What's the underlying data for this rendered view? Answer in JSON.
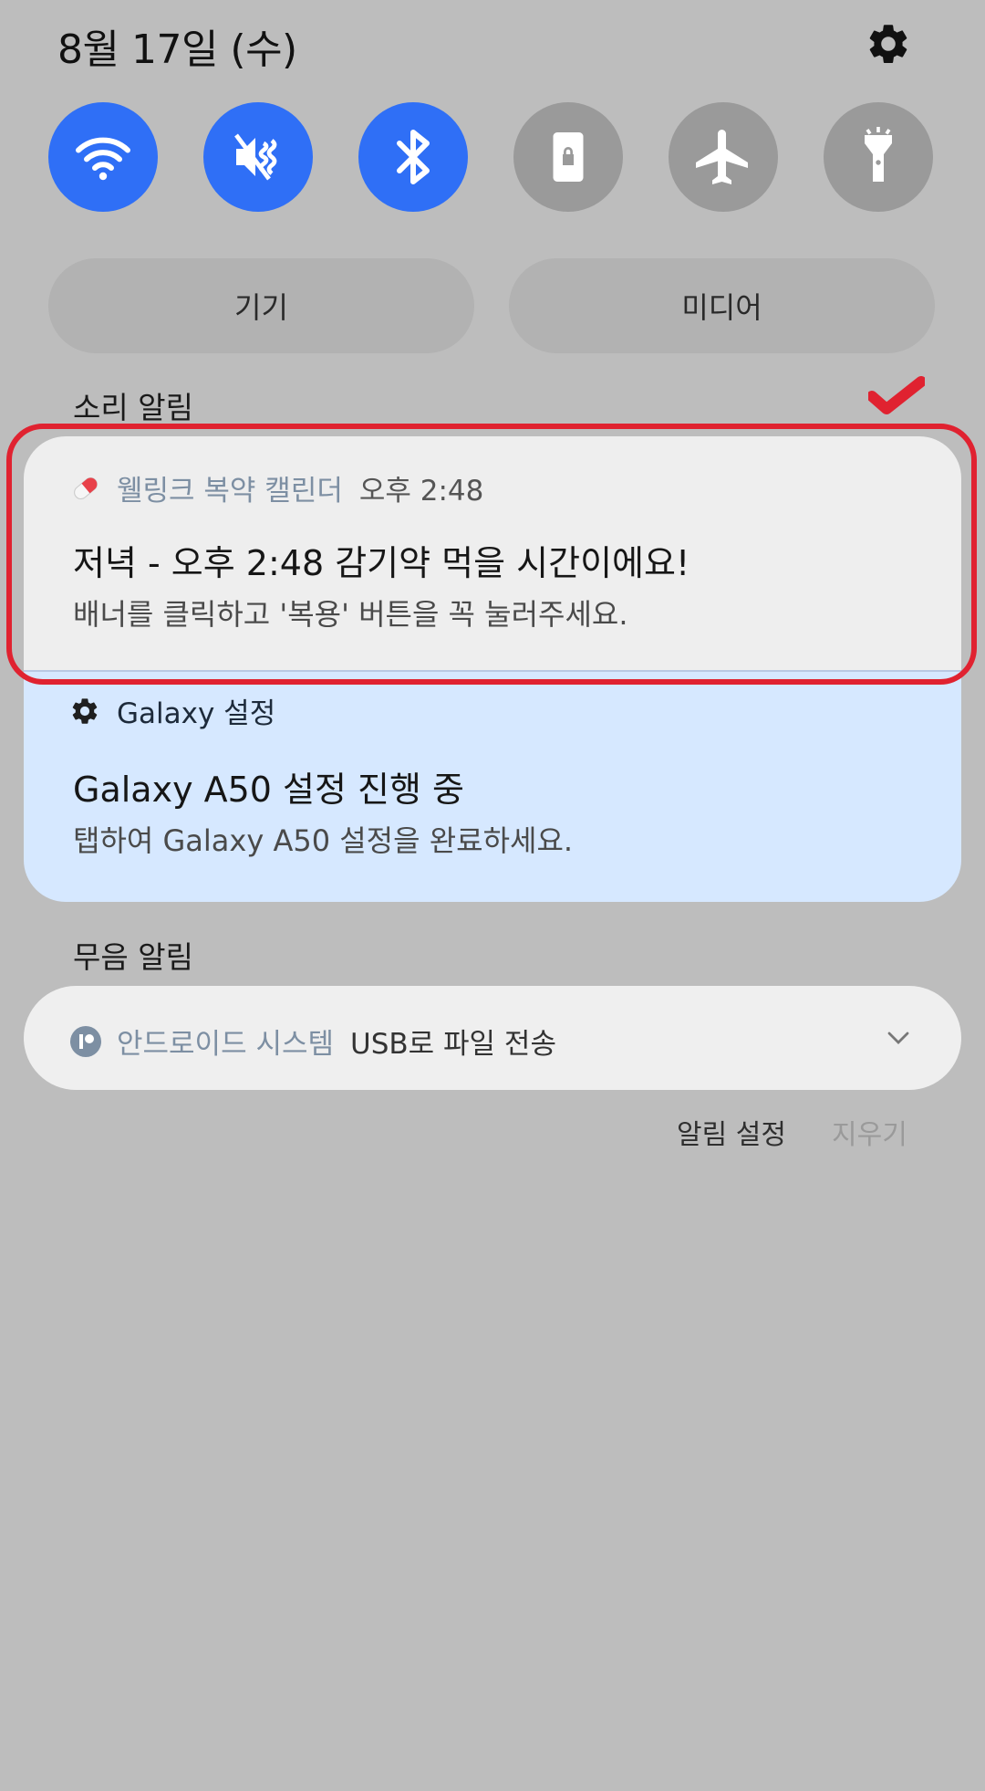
{
  "status": {
    "date": "8월 17일 (수)"
  },
  "quick_settings": [
    {
      "name": "wifi",
      "state": "on"
    },
    {
      "name": "sound-mute",
      "state": "on"
    },
    {
      "name": "bluetooth",
      "state": "on"
    },
    {
      "name": "screen-lock",
      "state": "off"
    },
    {
      "name": "airplane",
      "state": "off"
    },
    {
      "name": "flashlight",
      "state": "off"
    }
  ],
  "output_tabs": {
    "device": "기기",
    "media": "미디어"
  },
  "sections": {
    "sound": "소리 알림",
    "silent": "무음 알림"
  },
  "notifications": [
    {
      "app": "웰링크 복약 캘린더",
      "time": "오후 2:48",
      "title": "저녁 - 오후 2:48  감기약 먹을 시간이에요!",
      "text": "배너를 클릭하고 '복용' 버튼을 꼭 눌러주세요."
    },
    {
      "app": "Galaxy 설정",
      "title": "Galaxy A50 설정 진행 중",
      "text": "탭하여 Galaxy A50 설정을 완료하세요."
    }
  ],
  "silent_notification": {
    "app": "안드로이드 시스템",
    "text": "USB로 파일 전송"
  },
  "footer": {
    "settings": "알림 설정",
    "clear": "지우기"
  },
  "colors": {
    "accent_on": "#2f6ff6",
    "off": "#9a9a9a",
    "highlight": "#e02230"
  }
}
